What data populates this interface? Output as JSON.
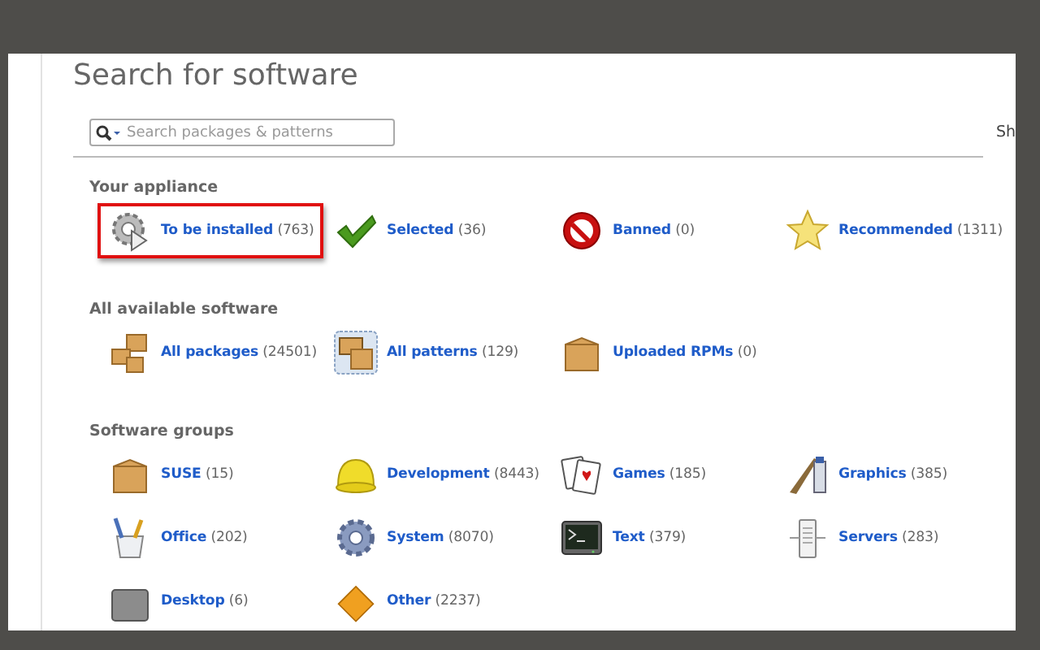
{
  "title": "Search for software",
  "search": {
    "placeholder": "Search packages & patterns"
  },
  "side_text": "Sh",
  "sections": [
    {
      "heading": "Your appliance",
      "items": [
        {
          "label": "To be installed",
          "count": "(763)",
          "selected": true
        },
        {
          "label": "Selected",
          "count": "(36)",
          "selected": false
        },
        {
          "label": "Banned",
          "count": "(0)",
          "selected": false
        },
        {
          "label": "Recommended",
          "count": "(1311)",
          "selected": false
        }
      ]
    },
    {
      "heading": "All available software",
      "items": [
        {
          "label": "All packages",
          "count": "(24501)",
          "selected": false
        },
        {
          "label": "All patterns",
          "count": "(129)",
          "selected": false
        },
        {
          "label": "Uploaded RPMs",
          "count": "(0)",
          "selected": false
        }
      ]
    },
    {
      "heading": "Software groups",
      "items": [
        {
          "label": "SUSE",
          "count": "(15)",
          "selected": false
        },
        {
          "label": "Development",
          "count": "(8443)",
          "selected": false
        },
        {
          "label": "Games",
          "count": "(185)",
          "selected": false
        },
        {
          "label": "Graphics",
          "count": "(385)",
          "selected": false
        },
        {
          "label": "Office",
          "count": "(202)",
          "selected": false
        },
        {
          "label": "System",
          "count": "(8070)",
          "selected": false
        },
        {
          "label": "Text",
          "count": "(379)",
          "selected": false
        },
        {
          "label": "Servers",
          "count": "(283)",
          "selected": false
        },
        {
          "label": "Desktop",
          "count": "(6)",
          "selected": false
        },
        {
          "label": "Other",
          "count": "(2237)",
          "selected": false
        }
      ]
    }
  ]
}
